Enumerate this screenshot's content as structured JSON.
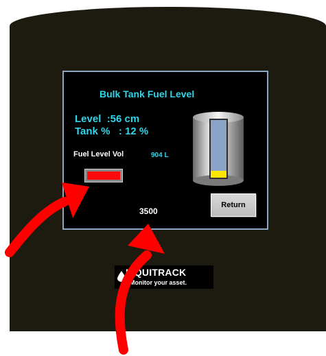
{
  "hmi": {
    "title": "Bulk Tank Fuel Level",
    "level_line": "Level  :56 cm",
    "tank_line": "Tank %   : 12 %",
    "fuel_label": "Fuel Level Vol",
    "fuel_value": "904 L",
    "tank_fill_fraction": 0.12,
    "setpoint_value": "3500",
    "return_label": "Return"
  },
  "logo": {
    "brand": "LIQUITRACK",
    "tagline": "Monitor your asset."
  },
  "colors": {
    "accent": "#2fd6ea",
    "alarm": "#ff0a0a",
    "fill": "#ffe600",
    "annotation_arrow": "#ff0000"
  }
}
